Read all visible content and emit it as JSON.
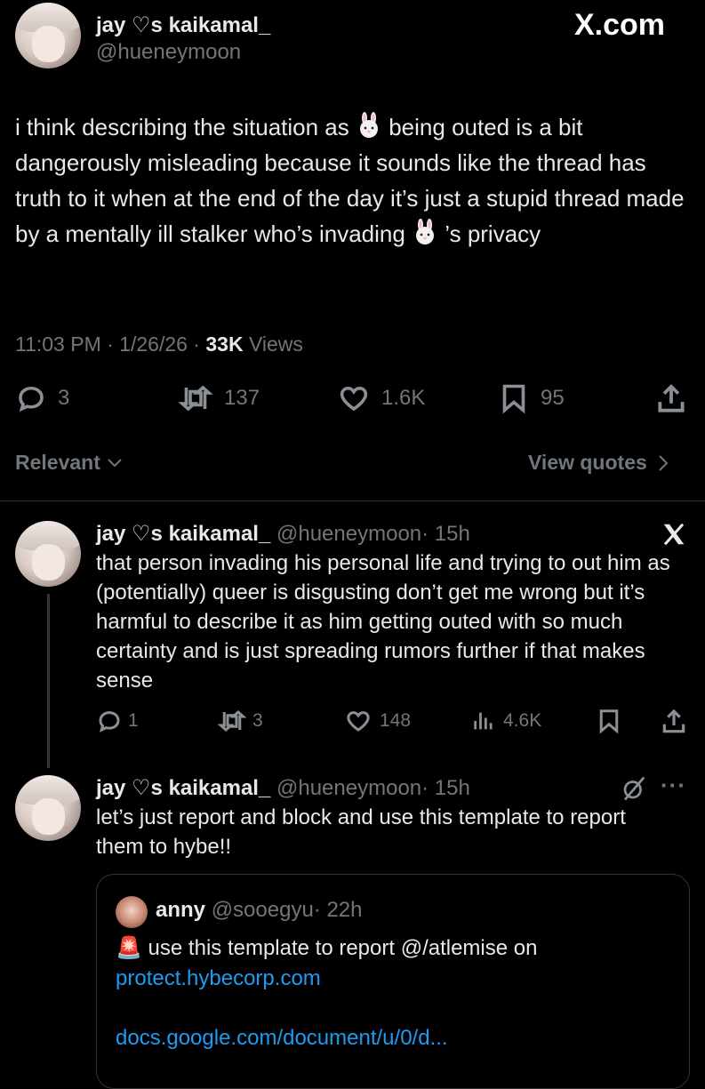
{
  "watermark": "X.com",
  "main_tweet": {
    "name": "jay ♡s kaikamal_",
    "handle": "@hueneymoon",
    "text_parts": [
      "i think describing the situation as ",
      " being outed is a bit dangerously misleading because it sounds like the thread has truth to it when at the end of the day it’s just a stupid thread made by a mentally ill stalker who’s invading ",
      " ’s privacy"
    ],
    "meta_time": "11:03 PM · 1/26/26 · ",
    "meta_views_count": "33K",
    "meta_views_label": " Views",
    "replies": "3",
    "reposts": "137",
    "likes": "1.6K",
    "bookmarks": "95"
  },
  "sort": {
    "relevant": "Relevant",
    "view_quotes": "View quotes"
  },
  "reply1": {
    "name": "jay ♡s kaikamal_",
    "handle": "@hueneymoon",
    "time": "· 15h",
    "text": "that person invading his personal life and trying to out him as (potentially) queer is disgusting don’t get me wrong but it’s harmful to describe it as him getting outed with so much certainty and is just spreading rumors further if that makes sense",
    "replies": "1",
    "reposts": "3",
    "likes": "148",
    "views": "4.6K"
  },
  "reply2": {
    "name": "jay ♡s kaikamal_",
    "handle": "@hueneymoon",
    "time": "· 15h",
    "text": "let’s just report and block and use this template to report them to hybe!!",
    "more": "···"
  },
  "quote": {
    "name": "anny",
    "handle": "@sooegyu",
    "time": "· 22h",
    "siren": "🚨",
    "text": " use this template to report @/atlemise on",
    "link1": "protect.hybecorp.com",
    "link2": "docs.google.com/document/u/0/d..."
  }
}
